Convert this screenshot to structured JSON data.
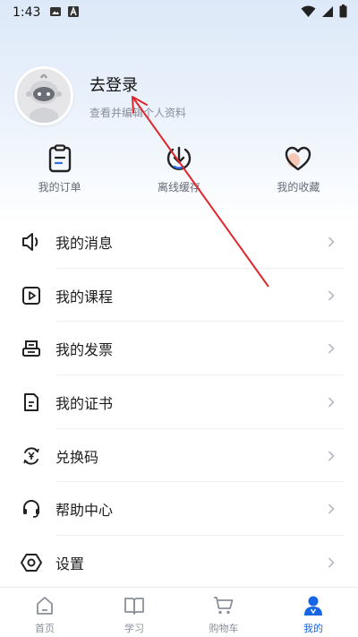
{
  "status_bar": {
    "time": "1:43",
    "left_icons": [
      "image-icon",
      "a-badge-icon"
    ],
    "right_icons": [
      "wifi-icon",
      "signal-icon",
      "battery-icon"
    ]
  },
  "profile": {
    "title": "去登录",
    "subtitle": "查看并编辑个人资料",
    "avatar": "robot-avatar"
  },
  "quick_actions": [
    {
      "label": "我的订单",
      "icon": "clipboard-icon"
    },
    {
      "label": "离线缓存",
      "icon": "download-icon"
    },
    {
      "label": "我的收藏",
      "icon": "heart-icon"
    }
  ],
  "menu": [
    {
      "label": "我的消息",
      "icon": "speaker-icon"
    },
    {
      "label": "我的课程",
      "icon": "play-icon"
    },
    {
      "label": "我的发票",
      "icon": "invoice-icon"
    },
    {
      "label": "我的证书",
      "icon": "document-icon"
    },
    {
      "label": "兑换码",
      "icon": "yen-exchange-icon"
    },
    {
      "label": "帮助中心",
      "icon": "headset-icon"
    },
    {
      "label": "设置",
      "icon": "hexagon-settings-icon"
    }
  ],
  "bottom_nav": [
    {
      "label": "首页",
      "icon": "home-icon",
      "active": false
    },
    {
      "label": "学习",
      "icon": "book-icon",
      "active": false
    },
    {
      "label": "购物车",
      "icon": "cart-icon",
      "active": false
    },
    {
      "label": "我的",
      "icon": "person-icon",
      "active": true
    }
  ],
  "colors": {
    "accent": "#1565e6",
    "annotation_arrow": "#e0262b",
    "heart_fill": "#f6c7b5",
    "download_accent": "#2f6fe8"
  }
}
